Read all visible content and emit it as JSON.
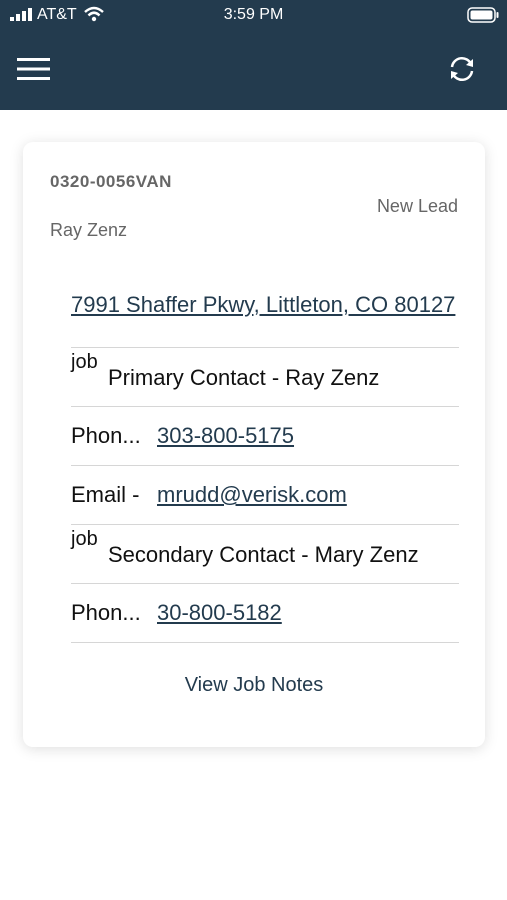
{
  "status_bar": {
    "carrier": "AT&T",
    "time": "3:59 PM"
  },
  "colors": {
    "header_bg": "#233b4e",
    "link": "#233b4e",
    "divider": "#d6d6d6"
  },
  "header": {
    "menu_icon": "hamburger-menu-icon",
    "sync_icon": "sync-icon"
  },
  "job": {
    "id": "0320-0056VAN",
    "status": "New Lead",
    "customer": "Ray Zenz",
    "address": "7991 Shaffer Pkwy, Littleton, CO 80127",
    "primary_contact": {
      "tag": "job",
      "label": "Primary Contact - Ray Zenz",
      "phone_label": "Phon...",
      "phone": "303-800-5175",
      "email_label": "Email -",
      "email": "mrudd@verisk.com"
    },
    "secondary_contact": {
      "tag": "job",
      "label": "Secondary Contact - Mary Zenz",
      "phone_label": "Phon...",
      "phone": "30-800-5182"
    },
    "notes_link": "View Job Notes"
  }
}
